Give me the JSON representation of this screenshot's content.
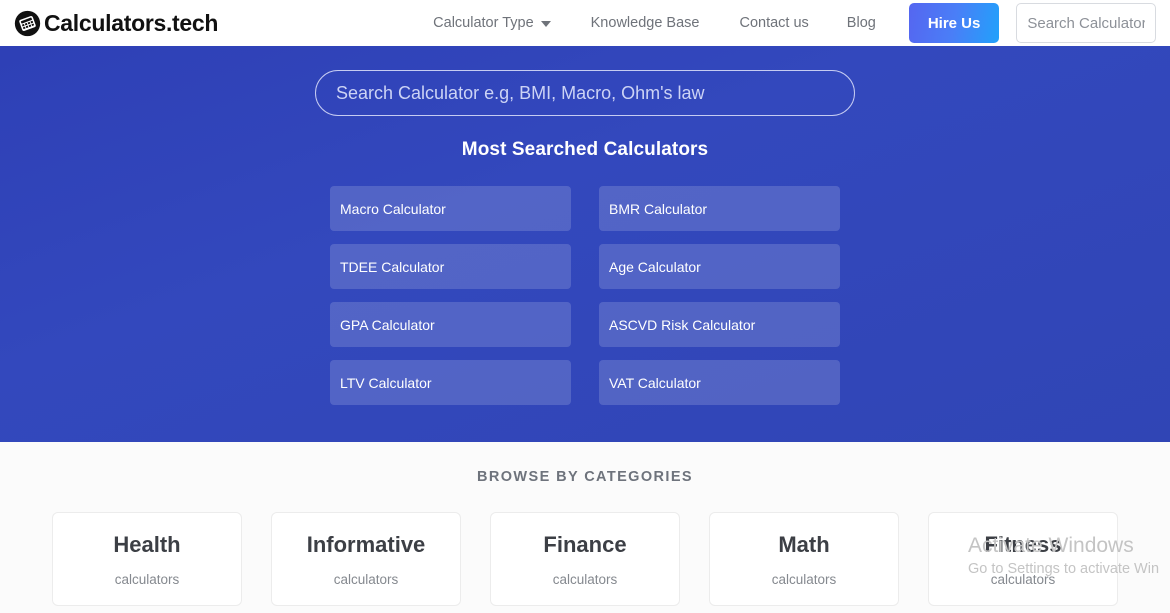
{
  "navbar": {
    "brand": {
      "name": "Calculators.tech",
      "logo_icon": "calculator-circle-icon"
    },
    "links": [
      {
        "label": "Calculator Type",
        "has_caret": true
      },
      {
        "label": "Knowledge Base",
        "has_caret": false
      },
      {
        "label": "Contact us",
        "has_caret": false
      },
      {
        "label": "Blog",
        "has_caret": false
      }
    ],
    "hire_us_label": "Hire Us",
    "search": {
      "value": "",
      "placeholder": "Search Calculator"
    },
    "accent_gradient_from": "#5566f0",
    "accent_gradient_to": "#21a1fb"
  },
  "hero": {
    "background_color": "#3045b5",
    "search": {
      "value": "",
      "placeholder": "Search Calculator e.g, BMI, Macro, Ohm's law"
    },
    "heading": "Most Searched Calculators",
    "calculators": [
      {
        "label": "Macro Calculator"
      },
      {
        "label": "BMR Calculator"
      },
      {
        "label": "TDEE Calculator"
      },
      {
        "label": "Age Calculator"
      },
      {
        "label": "GPA Calculator"
      },
      {
        "label": "ASCVD Risk Calculator"
      },
      {
        "label": "LTV Calculator"
      },
      {
        "label": "VAT Calculator"
      }
    ]
  },
  "categories": {
    "title": "BROWSE BY CATEGORIES",
    "items": [
      {
        "name": "Health",
        "sub": "calculators"
      },
      {
        "name": "Informative",
        "sub": "calculators"
      },
      {
        "name": "Finance",
        "sub": "calculators"
      },
      {
        "name": "Math",
        "sub": "calculators"
      },
      {
        "name": "Fitness",
        "sub": "calculators"
      }
    ]
  },
  "windows_watermark": {
    "title": "Activate Windows",
    "subtitle": "Go to Settings to activate Win"
  }
}
